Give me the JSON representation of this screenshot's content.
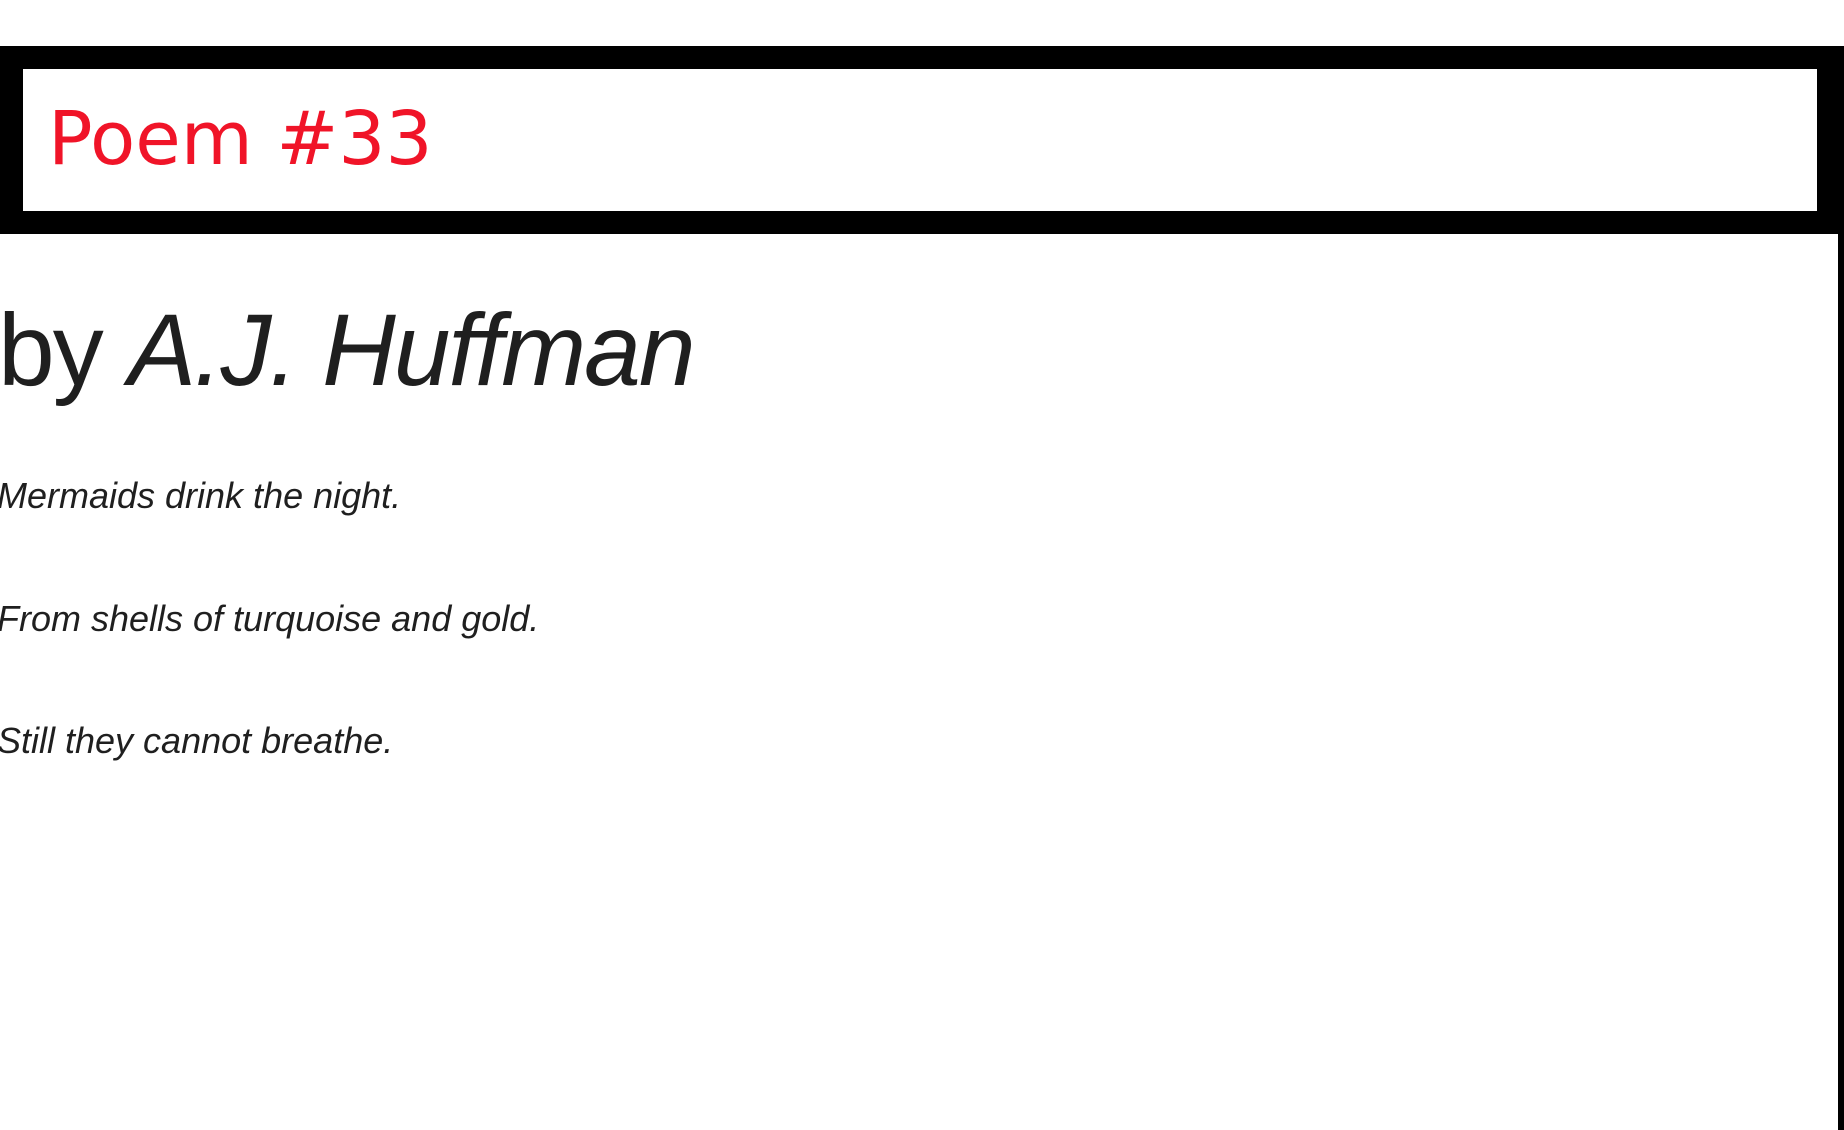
{
  "header": {
    "title": "Poem #33",
    "title_color": "#f01428"
  },
  "byline": {
    "prefix": "by",
    "author": "A.J. Huffman"
  },
  "poem": {
    "lines": [
      "Mermaids drink the night.",
      "From shells of turquoise and gold.",
      "Still they cannot breathe."
    ]
  },
  "colors": {
    "border": "#000000",
    "text": "#1f1f1f",
    "background": "#ffffff"
  }
}
